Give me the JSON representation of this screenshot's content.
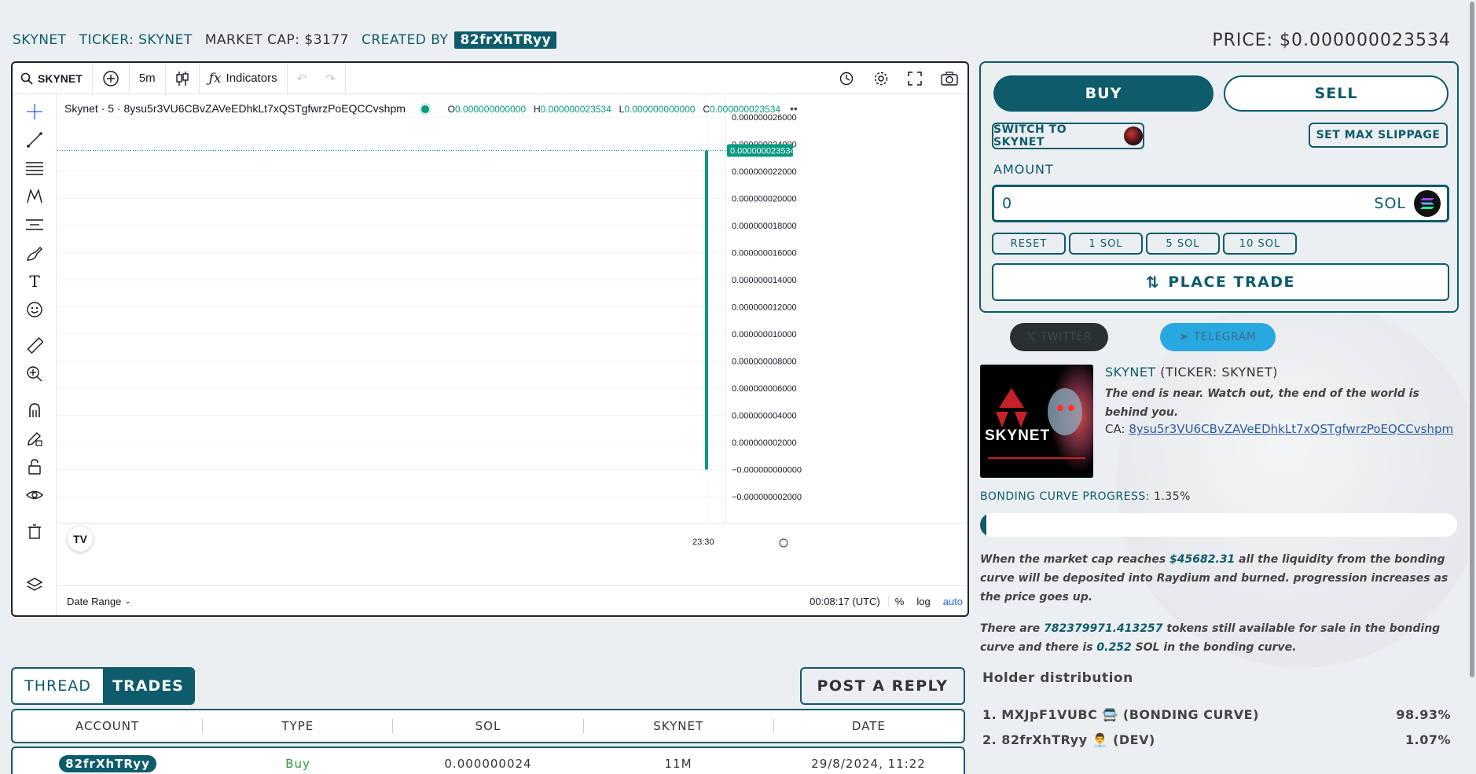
{
  "header": {
    "name": "SKYNET",
    "ticker": "TICKER: SKYNET",
    "market_cap": "MARKET CAP: $3177",
    "created_by_label": "CREATED BY",
    "creator": "82frXhTRyy",
    "price": "PRICE:  $0.000000023534"
  },
  "chart": {
    "symbol": "SKYNET",
    "interval": "5m",
    "indicators_label": "Indicators",
    "legend_title": "Skynet · 5 · 8ysu5r3VU6CBvZAVeEDhkLt7xQSTgfwrzPoEQCCvshpm",
    "ohlc": {
      "o_label": "O",
      "o": "0.000000000000",
      "h_label": "H",
      "h": "0.000000023534",
      "l_label": "L",
      "l": "0.000000000000",
      "c_label": "C",
      "c": "0.000000023534"
    },
    "price_tag": "0.000000023534",
    "time_label": "23:30",
    "date_range_label": "Date Range",
    "clock": "00:08:17 (UTC)",
    "pct_label": "%",
    "log_label": "log",
    "auto_label": "auto",
    "colors": {
      "accent": "#089981",
      "grid": "#f0f3fa"
    }
  },
  "chart_data": {
    "type": "bar",
    "y_tick_labels": [
      "0.000000026000",
      "0.000000024000",
      "0.000000022000",
      "0.000000020000",
      "0.000000018000",
      "0.000000016000",
      "0.000000014000",
      "0.000000012000",
      "0.000000010000",
      "0.000000008000",
      "0.000000006000",
      "0.000000004000",
      "0.000000002000",
      "−0.000000000000",
      "−0.000000002000"
    ],
    "y_ticks": [
      2.6e-08,
      2.4e-08,
      2.2e-08,
      2e-08,
      1.8e-08,
      1.6e-08,
      1.4e-08,
      1.2e-08,
      1e-08,
      8e-09,
      6e-09,
      4e-09,
      2e-09,
      0,
      -2e-09
    ],
    "ylim": [
      -2e-09,
      2.6e-08
    ],
    "candles": [
      {
        "time": "23:30",
        "open": 0.0,
        "high": 2.3534e-08,
        "low": 0.0,
        "close": 2.3534e-08
      }
    ],
    "last_price": 2.3534e-08
  },
  "trade": {
    "buy_label": "BUY",
    "sell_label": "SELL",
    "switch_label": "SWITCH TO SKYNET",
    "slippage_label": "SET MAX SLIPPAGE",
    "amount_label": "AMOUNT",
    "amount_value": "0",
    "currency": "SOL",
    "quick": [
      "RESET",
      "1 SOL",
      "5 SOL",
      "10 SOL"
    ],
    "place_label": "PLACE TRADE"
  },
  "social": {
    "twitter": "TWITTER",
    "telegram": "TELEGRAM"
  },
  "token": {
    "name": "SKYNET",
    "ticker": "(TICKER: SKYNET)",
    "description": "The end is near. Watch out, the end of the world is behind you.",
    "ca_label": "CA:",
    "ca": "8ysu5r3VU6CBvZAVeEDhkLt7xQSTgfwrzPoEQCCvshpm",
    "image_text": "SKYNET"
  },
  "bonding": {
    "label": "BONDING CURVE PROGRESS:",
    "percent_text": "1.35%",
    "progress_percent": 1.35,
    "para1_pre": "When the market cap reaches ",
    "para1_cap": "$45682.31",
    "para1_post": " all the liquidity from the bonding curve will be deposited into Raydium and burned. progression increases as the price goes up.",
    "para2_pre": "There are ",
    "para2_tokens": "782379971.413257",
    "para2_mid": " tokens still available for sale in the bonding curve and there is ",
    "para2_sol": "0.252",
    "para2_post": " SOL in the bonding curve."
  },
  "holders": {
    "title": "Holder distribution",
    "rows": [
      {
        "label": "1. MXJpF1VUBC 🚍 (BONDING CURVE)",
        "pct": "98.93%"
      },
      {
        "label": "2. 82frXhTRyy 👨‍💼 (DEV)",
        "pct": "1.07%"
      }
    ]
  },
  "trades": {
    "tab_thread": "THREAD",
    "tab_trades": "TRADES",
    "post_label": "POST A REPLY",
    "columns": [
      "ACCOUNT",
      "TYPE",
      "SOL",
      "SKYNET",
      "DATE"
    ],
    "rows": [
      {
        "account": "82frXhTRyy",
        "type": "Buy",
        "sol": "0.000000024",
        "amount": "11M",
        "date": "29/8/2024, 11:22"
      }
    ]
  }
}
